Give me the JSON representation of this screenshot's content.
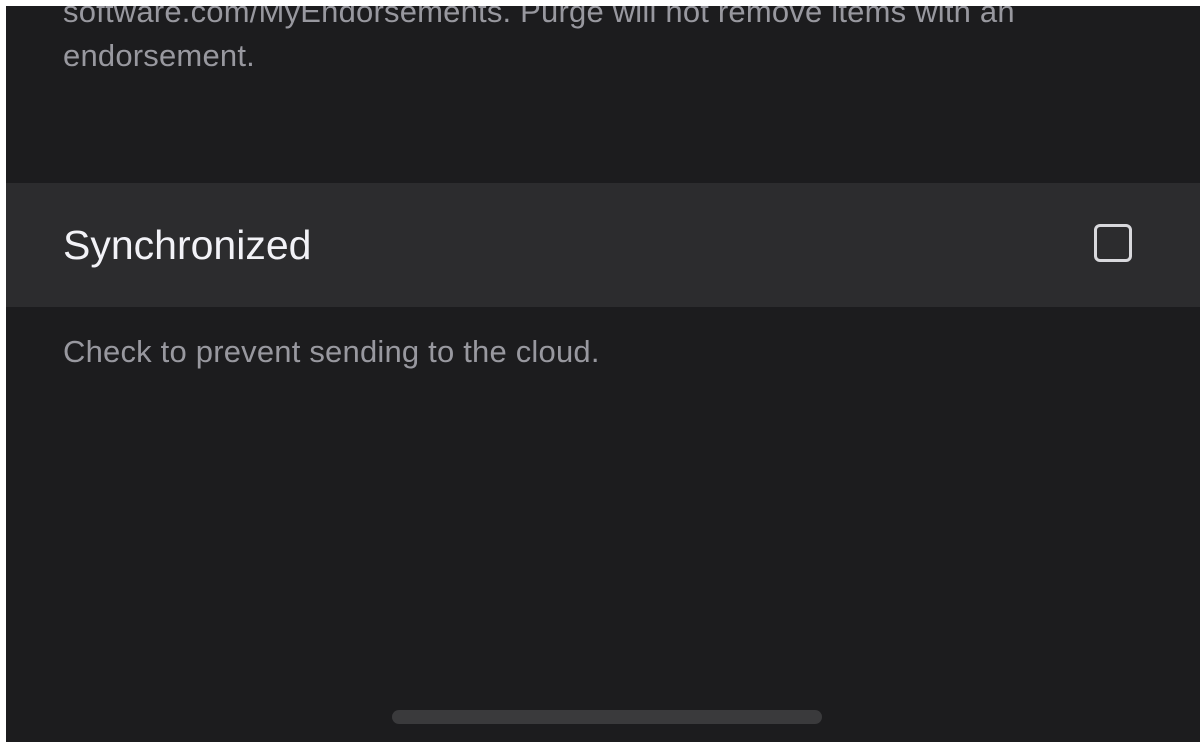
{
  "settings": {
    "previous_section_footer": "software.com/MyEndorsements. Purge will not remove items with an endorsement.",
    "synchronized": {
      "label": "Synchronized",
      "checked": false,
      "footer": "Check to prevent sending to the cloud."
    }
  },
  "colors": {
    "background": "#1c1c1e",
    "row_background": "#2c2c2e",
    "primary_text": "#f2f2f7",
    "secondary_text": "#98989f"
  }
}
